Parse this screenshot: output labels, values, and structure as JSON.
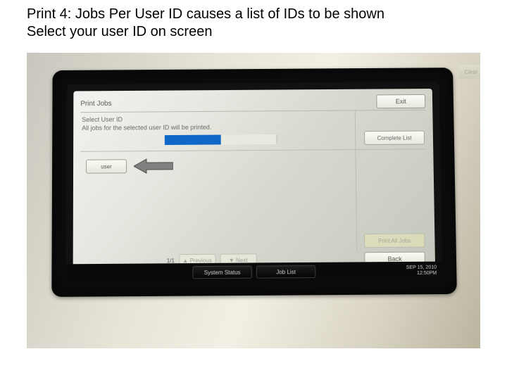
{
  "caption": {
    "line1": "Print 4: Jobs Per User ID causes a list of IDs to be shown",
    "line2": "Select your user ID on screen"
  },
  "printer_screen": {
    "title": "Print Jobs",
    "exit": "Exit",
    "instruction_line1": "Select User ID",
    "instruction_line2": "All jobs for the selected user ID will be printed.",
    "complete_list": "Complete List",
    "user_button": "user",
    "print_all": "Print All Jobs",
    "back": "Back",
    "pager": {
      "label": "1/1",
      "prev": "▲ Previous",
      "next": "▼ Next"
    },
    "status": {
      "system_status": "System Status",
      "job_list": "Job List"
    },
    "datetime": {
      "date": "SEP 15, 2010",
      "time": "12:50PM"
    }
  },
  "device": {
    "badge": "Clear"
  }
}
